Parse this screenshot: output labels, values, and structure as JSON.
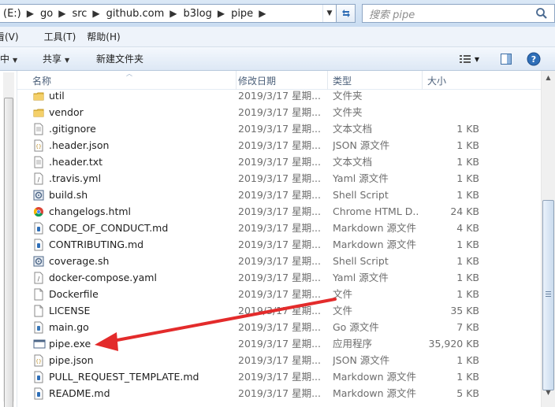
{
  "address": {
    "crumbs": [
      "(E:)",
      "go",
      "src",
      "github.com",
      "b3log",
      "pipe"
    ],
    "search_placeholder": "搜索 pipe"
  },
  "menu": [
    "看(V)",
    "工具(T)",
    "帮助(H)"
  ],
  "toolbar": {
    "left_cut": "中",
    "share_label": "共享",
    "new_folder_label": "新建文件夹"
  },
  "columns": {
    "name": "名称",
    "date": "修改日期",
    "type": "类型",
    "size": "大小"
  },
  "files": [
    {
      "name": "util",
      "date": "2019/3/17 星期...",
      "type": "文件夹",
      "size": "",
      "icon": "folder-icon"
    },
    {
      "name": "vendor",
      "date": "2019/3/17 星期...",
      "type": "文件夹",
      "size": "",
      "icon": "folder-icon"
    },
    {
      "name": ".gitignore",
      "date": "2019/3/17 星期...",
      "type": "文本文档",
      "size": "1 KB",
      "icon": "text-file-icon"
    },
    {
      "name": ".header.json",
      "date": "2019/3/17 星期...",
      "type": "JSON 源文件",
      "size": "1 KB",
      "icon": "json-file-icon"
    },
    {
      "name": ".header.txt",
      "date": "2019/3/17 星期...",
      "type": "文本文档",
      "size": "1 KB",
      "icon": "text-file-icon"
    },
    {
      "name": ".travis.yml",
      "date": "2019/3/17 星期...",
      "type": "Yaml 源文件",
      "size": "1 KB",
      "icon": "yaml-file-icon"
    },
    {
      "name": "build.sh",
      "date": "2019/3/17 星期...",
      "type": "Shell Script",
      "size": "1 KB",
      "icon": "shell-script-icon"
    },
    {
      "name": "changelogs.html",
      "date": "2019/3/17 星期...",
      "type": "Chrome HTML D...",
      "size": "24 KB",
      "icon": "chrome-html-icon"
    },
    {
      "name": "CODE_OF_CONDUCT.md",
      "date": "2019/3/17 星期...",
      "type": "Markdown 源文件",
      "size": "4 KB",
      "icon": "markdown-file-icon"
    },
    {
      "name": "CONTRIBUTING.md",
      "date": "2019/3/17 星期...",
      "type": "Markdown 源文件",
      "size": "1 KB",
      "icon": "markdown-file-icon"
    },
    {
      "name": "coverage.sh",
      "date": "2019/3/17 星期...",
      "type": "Shell Script",
      "size": "1 KB",
      "icon": "shell-script-icon"
    },
    {
      "name": "docker-compose.yaml",
      "date": "2019/3/17 星期...",
      "type": "Yaml 源文件",
      "size": "1 KB",
      "icon": "yaml-file-icon"
    },
    {
      "name": "Dockerfile",
      "date": "2019/3/17 星期...",
      "type": "文件",
      "size": "1 KB",
      "icon": "blank-file-icon"
    },
    {
      "name": "LICENSE",
      "date": "2019/3/17 星期...",
      "type": "文件",
      "size": "35 KB",
      "icon": "blank-file-icon"
    },
    {
      "name": "main.go",
      "date": "2019/3/17 星期...",
      "type": "Go 源文件",
      "size": "7 KB",
      "icon": "go-file-icon"
    },
    {
      "name": "pipe.exe",
      "date": "2019/3/17 星期...",
      "type": "应用程序",
      "size": "35,920 KB",
      "icon": "exe-file-icon"
    },
    {
      "name": "pipe.json",
      "date": "2019/3/17 星期...",
      "type": "JSON 源文件",
      "size": "1 KB",
      "icon": "json-file-icon"
    },
    {
      "name": "PULL_REQUEST_TEMPLATE.md",
      "date": "2019/3/17 星期...",
      "type": "Markdown 源文件",
      "size": "1 KB",
      "icon": "markdown-file-icon"
    },
    {
      "name": "README.md",
      "date": "2019/3/17 星期...",
      "type": "Markdown 源文件",
      "size": "5 KB",
      "icon": "markdown-file-icon"
    }
  ],
  "colors": {
    "annotation_arrow": "#e32b2b",
    "header_text": "#4c607a",
    "secondary_text": "#6d6d6d"
  }
}
